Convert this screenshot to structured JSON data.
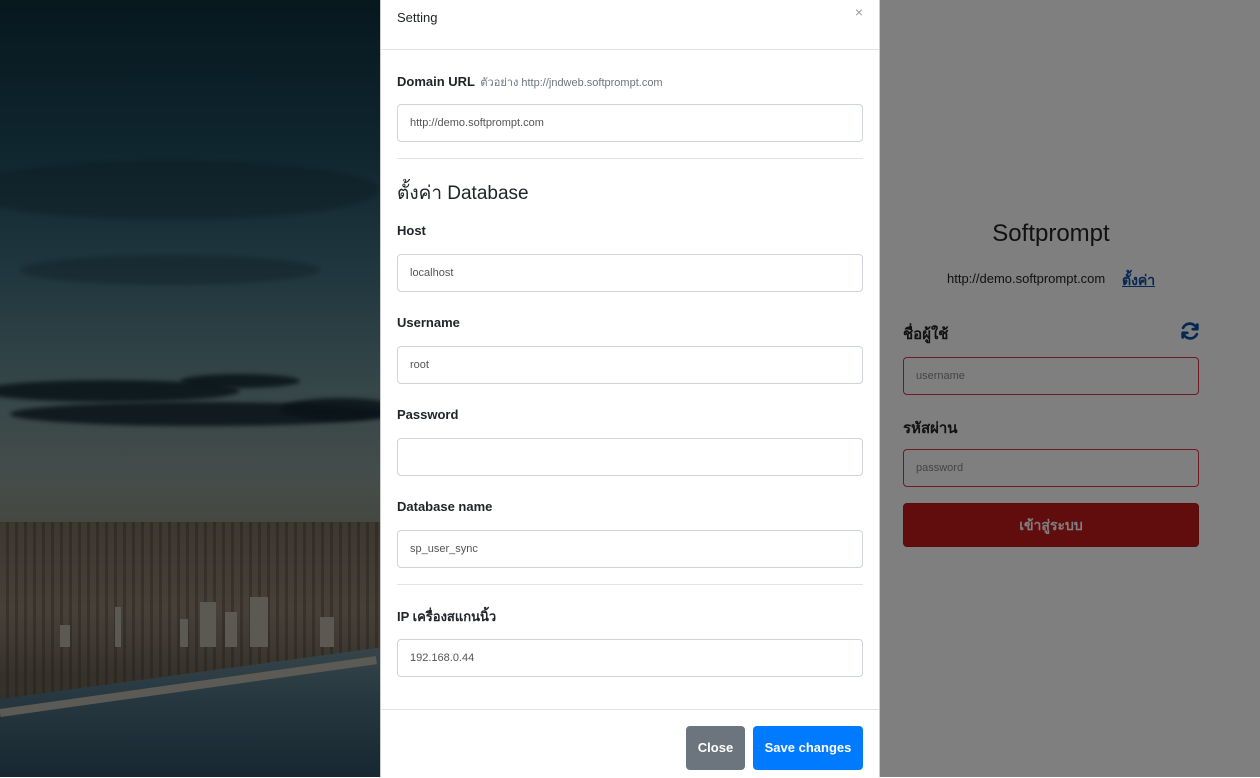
{
  "login": {
    "title": "Softprompt",
    "domain_url": "http://demo.softprompt.com",
    "settings_link": "ตั้งค่า",
    "username_label": "ชื่อผู้ใช้",
    "username_placeholder": "username",
    "password_label": "รหัสผ่าน",
    "password_placeholder": "password",
    "login_button": "เข้าสู่ระบบ",
    "accent_color": "#c51a1a"
  },
  "modal": {
    "title": "Setting",
    "close_symbol": "×",
    "domain_label": "Domain URL",
    "domain_hint": "ตัวอย่าง http://jndweb.softprompt.com",
    "domain_value": "http://demo.softprompt.com",
    "database_section_title": "ตั้งค่า Database",
    "host_label": "Host",
    "host_value": "localhost",
    "username_label": "Username",
    "username_value": "root",
    "password_label": "Password",
    "password_value": "",
    "database_name_label": "Database name",
    "database_name_value": "sp_user_sync",
    "scanner_ip_label": "IP เครื่องสแกนนิ้ว",
    "scanner_ip_value": "192.168.0.44",
    "close_button": "Close",
    "save_button": "Save changes",
    "primary_color": "#007bff",
    "secondary_color": "#6c757d"
  }
}
